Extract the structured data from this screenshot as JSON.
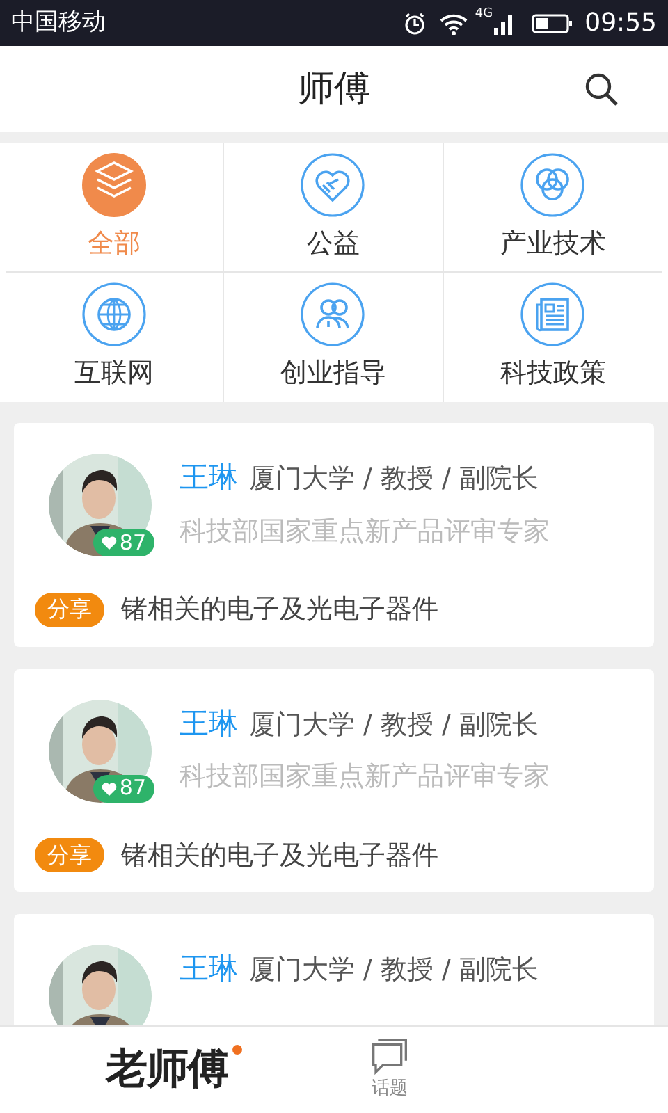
{
  "status_bar": {
    "carrier": "中国移动",
    "network": "4G",
    "time": "09:55"
  },
  "header": {
    "title": "师傅"
  },
  "categories": [
    {
      "label": "全部",
      "selected": true
    },
    {
      "label": "公益",
      "selected": false
    },
    {
      "label": "产业技术",
      "selected": false
    },
    {
      "label": "互联网",
      "selected": false
    },
    {
      "label": "创业指导",
      "selected": false
    },
    {
      "label": "科技政策",
      "selected": false
    }
  ],
  "experts": [
    {
      "name": "王琳",
      "affiliation": "厦门大学 / 教授 / 副院长",
      "title": "科技部国家重点新产品评审专家",
      "likes": "87",
      "tag": "分享",
      "topic": "锗相关的电子及光电子器件"
    },
    {
      "name": "王琳",
      "affiliation": "厦门大学 / 教授 / 副院长",
      "title": "科技部国家重点新产品评审专家",
      "likes": "87",
      "tag": "分享",
      "topic": "锗相关的电子及光电子器件"
    },
    {
      "name": "王琳",
      "affiliation": "厦门大学 / 教授 / 副院长"
    }
  ],
  "bottom_bar": {
    "logo": "老师傅",
    "tabs": [
      {
        "label": "话题"
      }
    ]
  }
}
